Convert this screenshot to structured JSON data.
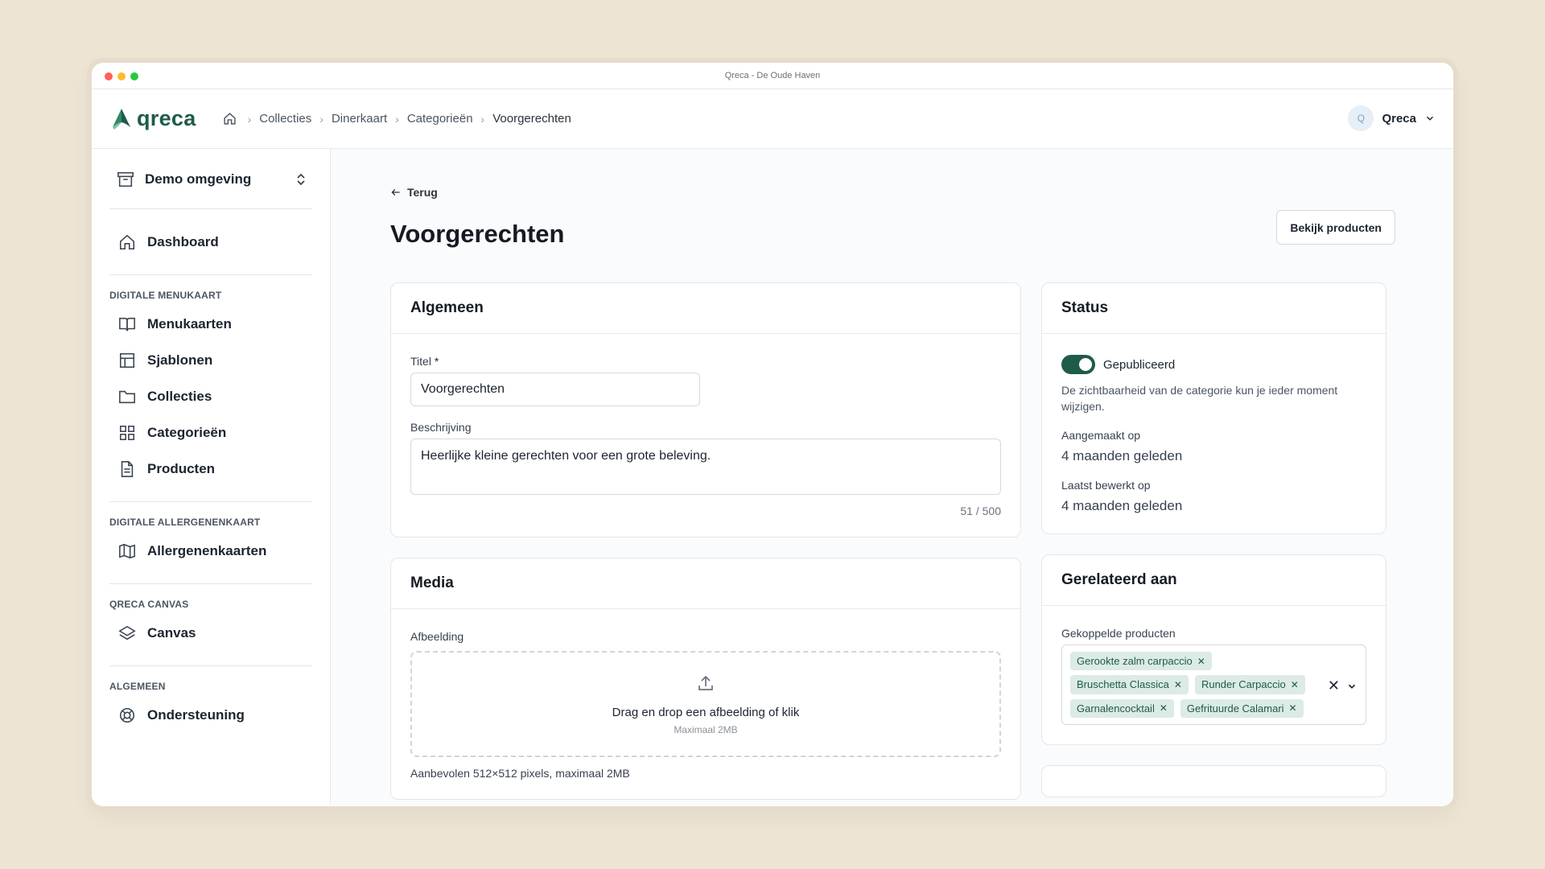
{
  "window": {
    "title": "Qreca - De Oude Haven"
  },
  "brand": {
    "name": "qreca",
    "color": "#1e5b4a"
  },
  "breadcrumb": [
    {
      "label": "Collecties"
    },
    {
      "label": "Dinerkaart"
    },
    {
      "label": "Categorieën"
    },
    {
      "label": "Voorgerechten"
    }
  ],
  "user": {
    "initial": "Q",
    "name": "Qreca"
  },
  "sidebar": {
    "environment": "Demo omgeving",
    "dashboard": "Dashboard",
    "sections": [
      {
        "title": "DIGITALE MENUKAART",
        "items": [
          "Menukaarten",
          "Sjablonen",
          "Collecties",
          "Categorieën",
          "Producten"
        ]
      },
      {
        "title": "DIGITALE ALLERGENENKAART",
        "items": [
          "Allergenenkaarten"
        ]
      },
      {
        "title": "QRECA CANVAS",
        "items": [
          "Canvas"
        ]
      },
      {
        "title": "ALGEMEEN",
        "items": [
          "Ondersteuning"
        ]
      }
    ]
  },
  "main": {
    "back_label": "Terug",
    "title": "Voorgerechten",
    "products_button": "Bekijk producten",
    "general": {
      "heading": "Algemeen",
      "title_label": "Titel",
      "title_required": "*",
      "title_value": "Voorgerechten",
      "description_label": "Beschrijving",
      "description_value": "Heerlijke kleine gerechten voor een grote beleving.",
      "counter": "51 / 500"
    },
    "media": {
      "heading": "Media",
      "image_label": "Afbeelding",
      "drop_title": "Drag en drop een afbeelding of klik",
      "drop_sub": "Maximaal 2MB",
      "hint": "Aanbevolen 512×512 pixels, maximaal 2MB"
    },
    "status": {
      "heading": "Status",
      "toggle_label": "Gepubliceerd",
      "toggle_on": true,
      "note": "De zichtbaarheid van de categorie kun je ieder moment wijzigen.",
      "created_label": "Aangemaakt op",
      "created_value": "4 maanden geleden",
      "edited_label": "Laatst bewerkt op",
      "edited_value": "4 maanden geleden"
    },
    "related": {
      "heading": "Gerelateerd aan",
      "products_label": "Gekoppelde producten",
      "chips": [
        "Gerookte zalm carpaccio",
        "Bruschetta Classica",
        "Runder Carpaccio",
        "Garnalencocktail",
        "Gefrituurde Calamari"
      ],
      "clear_symbol": "✕"
    }
  },
  "icons": {
    "home": "home-icon",
    "archive": "archive-icon",
    "book": "book-open-icon",
    "layout": "layout-icon",
    "folder": "folder-icon",
    "grid": "grid-icon",
    "file": "file-text-icon",
    "map": "map-icon",
    "layers": "layers-icon",
    "lifebuoy": "lifebuoy-icon",
    "upload": "upload-icon"
  }
}
